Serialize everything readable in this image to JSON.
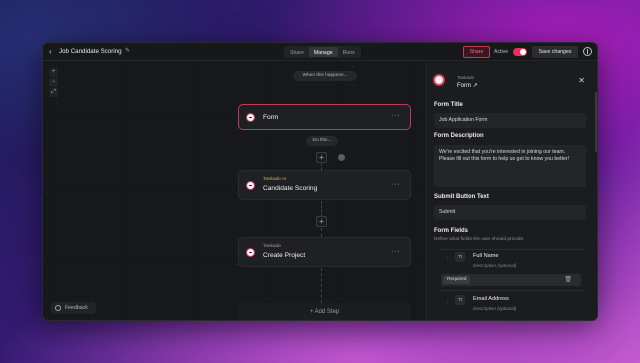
{
  "header": {
    "title": "Job Candidate Scoring",
    "tabs": [
      {
        "label": "Share"
      },
      {
        "label": "Manage"
      },
      {
        "label": "Runs"
      }
    ],
    "share_label": "Share",
    "active_label": "Active",
    "active_on": true,
    "save_label": "Save changes"
  },
  "canvas": {
    "zoom_buttons": [
      "+",
      "−",
      "⤢"
    ],
    "trigger_label": "When this happens...",
    "action_label": "Do this...",
    "nodes": [
      {
        "subtitle": "",
        "name": "Form"
      },
      {
        "subtitle": "Taskade AI",
        "name": "Candidate Scoring"
      },
      {
        "subtitle": "Taskade",
        "name": "Create Project"
      }
    ],
    "more_label": "···",
    "add_step_label": "+ Add Step",
    "feedback_label": "Feedback"
  },
  "panel": {
    "subtitle": "Taskade",
    "title": "Form ↗",
    "form_title_label": "Form Title",
    "form_title_value": "Job Application Form",
    "form_desc_label": "Form Description",
    "form_desc_value": "We're excited that you're interested in joining our team. Please fill out this form to help us get to know you better!",
    "submit_label": "Submit Button Text",
    "submit_value": "Submit",
    "fields_label": "Form Fields",
    "fields_desc": "Define what fields the user should provide.",
    "fields": [
      {
        "name": "Full Name",
        "description": "Description (optional)",
        "required_label": "Required"
      },
      {
        "name": "Email Address",
        "description": "Description (optional)"
      }
    ]
  },
  "colors": {
    "accent": "#e8305a",
    "window_bg": "#17181b",
    "selected_border": "#c23a55"
  }
}
